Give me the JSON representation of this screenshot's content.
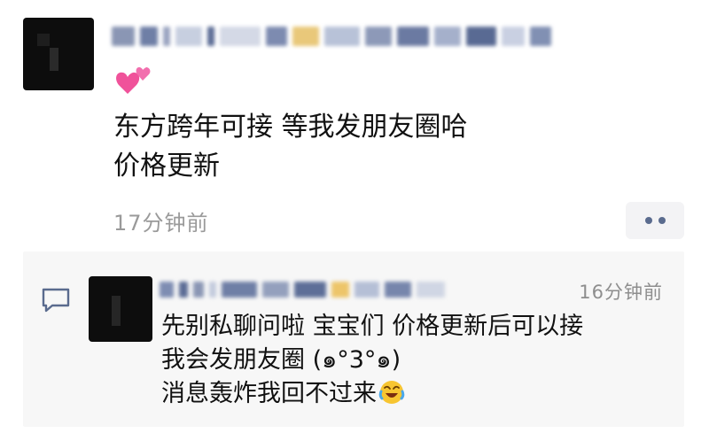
{
  "post": {
    "text": "东方跨年可接 等我发朋友圈哈\n价格更新",
    "time": "17分钟前",
    "emoji": "two-hearts-icon"
  },
  "comment": {
    "time": "16分钟前",
    "text": "先别私聊问啦 宝宝们 价格更新后可以接\n我会发朋友圈 (๑°3°๑)\n消息轰炸我回不过来",
    "emoji": "rofl-face-icon"
  },
  "colors": {
    "time_gray": "#9a9a9a",
    "dots_blue": "#5a6b8e",
    "comment_bg": "#f7f7f7",
    "comment_icon": "#5a6b8e"
  }
}
